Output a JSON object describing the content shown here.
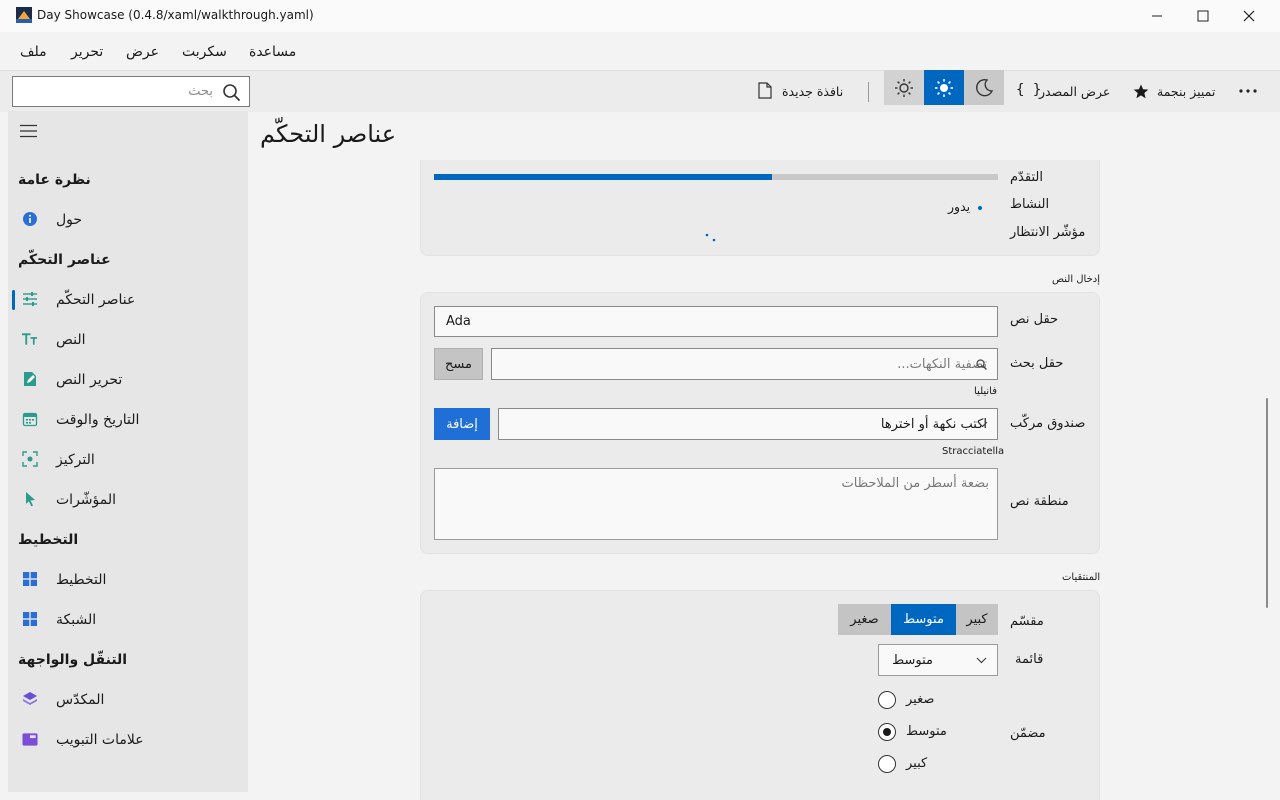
{
  "window": {
    "title": "Day Showcase (0.4.8/xaml/walkthrough.yaml)"
  },
  "menu": {
    "items": [
      "ملف",
      "تحرير",
      "عرض",
      "سكربت",
      "مساعدة"
    ]
  },
  "toolbar": {
    "search_placeholder": "بحث",
    "new_window": "نافذة جديدة",
    "view_source": "عرض المصدر",
    "star_label": "تمييز بنجمة",
    "active_theme": "light"
  },
  "sidebar": {
    "sections": [
      {
        "heading": "نظرة عامة",
        "items": [
          {
            "label": "حول",
            "icon": "info-icon"
          }
        ]
      },
      {
        "heading": "عناصر التحكّم",
        "items": [
          {
            "label": "عناصر التحكّم",
            "icon": "sliders-icon",
            "selected": true
          },
          {
            "label": "النص",
            "icon": "text-size-icon"
          },
          {
            "label": "تحرير النص",
            "icon": "edit-document-icon"
          },
          {
            "label": "التاريخ والوقت",
            "icon": "calendar-icon"
          },
          {
            "label": "التركيز",
            "icon": "focus-icon"
          },
          {
            "label": "المؤشّرات",
            "icon": "cursor-icon"
          }
        ]
      },
      {
        "heading": "التخطيط",
        "items": [
          {
            "label": "التخطيط",
            "icon": "layout-icon"
          },
          {
            "label": "الشبكة",
            "icon": "grid-icon"
          }
        ]
      },
      {
        "heading": "التنقّل والواجهة",
        "items": [
          {
            "label": "المكدّس",
            "icon": "stack-icon"
          },
          {
            "label": "علامات التبويب",
            "icon": "tabs-icon"
          }
        ]
      }
    ]
  },
  "page": {
    "title": "عناصر التحكّم"
  },
  "status_card": {
    "progress_label": "التقدّم",
    "progress_value": 0.6,
    "activity_label": "النشاط",
    "activity_state": "يدور",
    "spinner_label": "مؤشّر الانتظار"
  },
  "text_input": {
    "section_title": "إدخال النص",
    "text_field_label": "حقل نص",
    "text_field_value": "Ada",
    "search_label": "حقل بحث",
    "search_placeholder": "تصفية النكهات...",
    "clear_button": "مسح",
    "search_result": "فانيليا",
    "combo_label": "صندوق مركّب",
    "combo_placeholder": "اكتب نكهة أو اخترها",
    "add_button": "إضافة",
    "combo_result": "Stracciatella",
    "textarea_label": "منطقة نص",
    "textarea_placeholder": "بضعة أسطر من الملاحظات"
  },
  "pickers": {
    "section_title": "المنتقيات",
    "segmented_label": "مقسّم",
    "segments": [
      "كبير",
      "متوسط",
      "صغير"
    ],
    "segment_selected": "متوسط",
    "list_label": "قائمة",
    "list_value": "متوسط",
    "radio_label": "مضمّن",
    "radio_options": [
      "صغير",
      "متوسط",
      "كبير"
    ],
    "radio_selected": "متوسط"
  },
  "colors": {
    "accent": "#0067c0",
    "accent_button": "#1f6fd6",
    "progress_track": "#c8c8c8"
  }
}
